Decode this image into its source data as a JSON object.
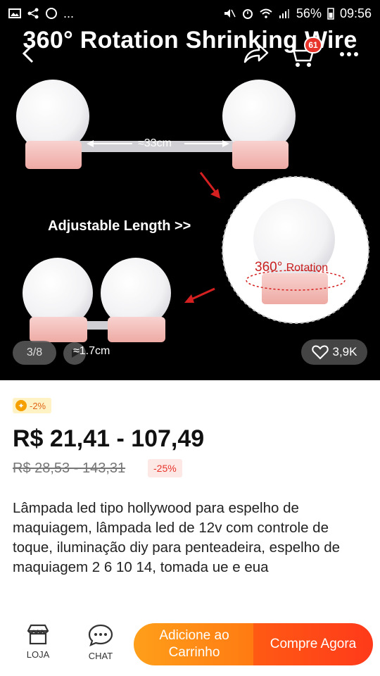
{
  "status_bar": {
    "notification_extra": "...",
    "battery_percent": "56%",
    "time": "09:56"
  },
  "hero": {
    "title": "360° Rotation Shrinking Wire",
    "measure_long": "≈33cm",
    "adjustable_label": "Adjustable Length >>",
    "rotation_number": "360°",
    "rotation_word": "Rotation",
    "measure_short": "≈1.7cm",
    "image_counter": "3/8",
    "likes": "3,9K"
  },
  "nav": {
    "cart_count": "61",
    "icons": [
      "back-arrow-icon",
      "share-icon",
      "cart-icon",
      "more-icon"
    ]
  },
  "product": {
    "coin_discount": "-2%",
    "price": "R$ 21,41 - 107,49",
    "old_price": "R$ 28,53 - 143,31",
    "discount": "-25%",
    "description": "Lâmpada led tipo hollywood para espelho de maquiagem, lâmpada led de 12v com controle de toque, iluminação diy para penteadeira, espelho de maquiagem 2 6 10 14, tomada ue e eua"
  },
  "bottom_bar": {
    "store_label": "LOJA",
    "chat_label": "CHAT",
    "add_to_cart": "Adicione ao Carrinho",
    "buy_now": "Compre Agora"
  },
  "colors": {
    "accent_orange": "#ff8c1a",
    "accent_red": "#ff3a1a",
    "badge_red": "#e8332a",
    "bulb_base_pink": "#f2b8b3"
  }
}
